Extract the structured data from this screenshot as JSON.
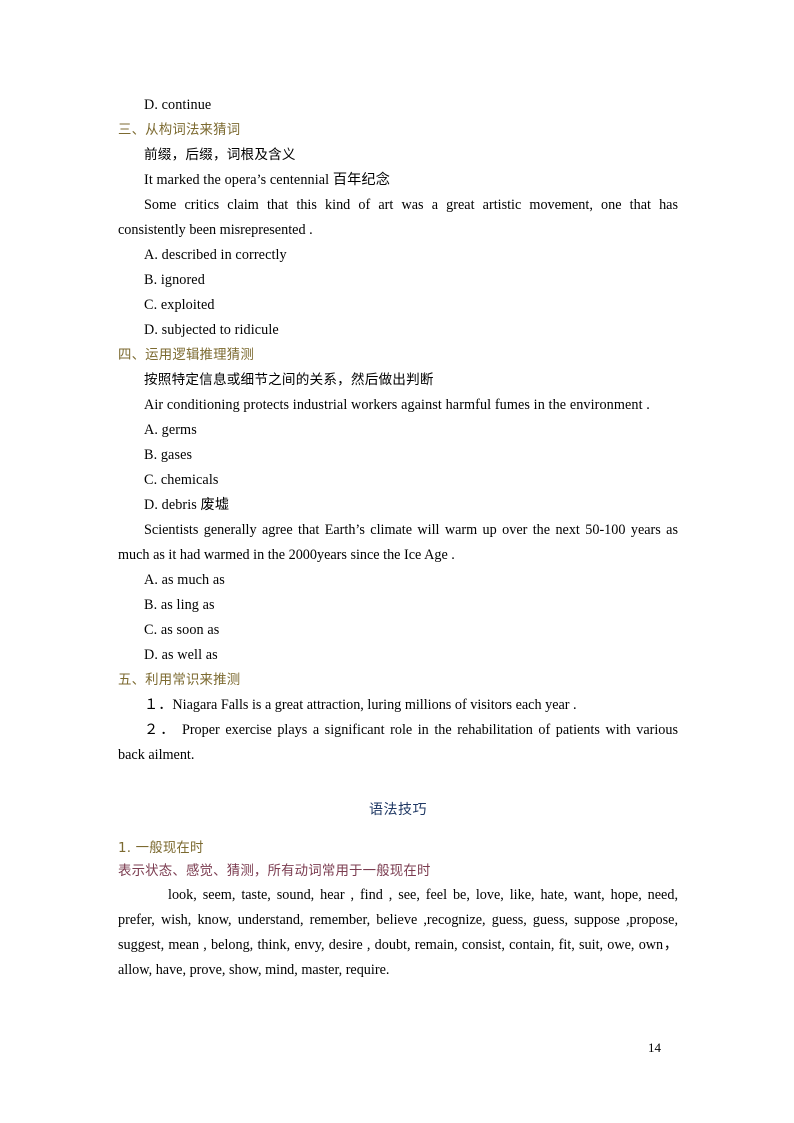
{
  "page": {
    "number": "14",
    "colors": {
      "heading_olive": "#7c6a30",
      "title_navy": "#1f3864",
      "note_rose": "#7b3c50",
      "body_black": "#000000"
    }
  },
  "top_option": "D. continue",
  "section_three": {
    "heading": "三、从构词法来猜词",
    "sub": "前缀，后缀，词根及含义",
    "example": "It marked the opera’s centennial  百年纪念",
    "question": "Some critics claim that this kind of art was a great artistic movement, one that has consistently been misrepresented .",
    "options": [
      "A. described in correctly",
      "B. ignored",
      "C. exploited",
      "D. subjected to ridicule"
    ]
  },
  "section_four": {
    "heading": "四、运用逻辑推理猜测",
    "sub": "按照特定信息或细节之间的关系，然后做出判断",
    "question1": "Air conditioning protects industrial workers against harmful fumes in the environment .",
    "options1": [
      "A. germs",
      "B. gases",
      "C. chemicals",
      "D. debris  废墟"
    ],
    "question2": "Scientists generally agree that Earth’s climate will warm up over the next 50-100 years as much as it had warmed in the 2000years since the Ice Age .",
    "options2": [
      "A. as much as",
      "B. as ling as",
      "C. as soon as",
      "D. as well as"
    ]
  },
  "section_five": {
    "heading": "五、利用常识来推测",
    "items": [
      "１．Niagara Falls is a great attraction, luring millions of visitors each year .",
      "２．  Proper exercise plays a significant role in the rehabilitation of patients with various back ailment."
    ]
  },
  "grammar": {
    "title": "语法技巧",
    "item_heading": "1. 一般现在时",
    "item_note": "表示状态、感觉、猜测，所有动词常用于一般现在时",
    "verb_list": "look, seem, taste, sound, hear  , find  , see, feel be, love, like, hate, want, hope, need, prefer, wish, know, understand, remember, believe  ,recognize, guess, guess, suppose  ,propose, suggest, mean  , belong, think, envy, desire  , doubt, remain, consist, contain, fit, suit, owe, own，  allow, have, prove, show, mind, master, require."
  }
}
